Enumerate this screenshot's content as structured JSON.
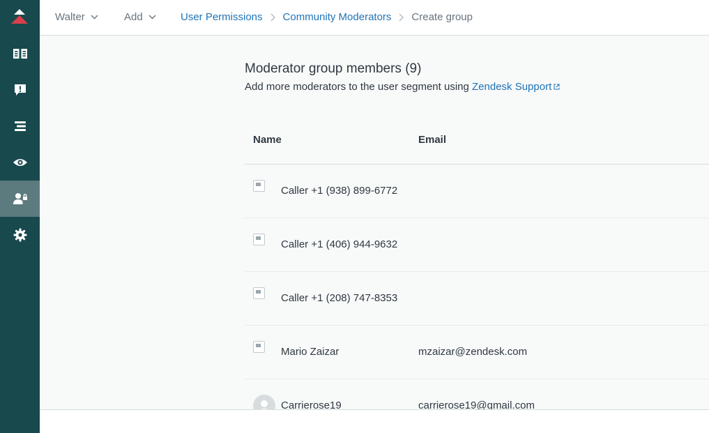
{
  "sidebar": {
    "logo_icon": "zendesk-guide-logo",
    "items": [
      {
        "icon": "open-book-icon",
        "active": false
      },
      {
        "icon": "alert-message-icon",
        "active": false
      },
      {
        "icon": "bars-list-icon",
        "active": false
      },
      {
        "icon": "eye-icon",
        "active": false
      },
      {
        "icon": "user-lock-icon",
        "active": true
      },
      {
        "icon": "gear-icon",
        "active": false
      }
    ],
    "colors": {
      "background": "#17494d",
      "active": "#5c7b7e",
      "logo_accent": "#d93f4c"
    }
  },
  "topbar": {
    "user_menu": "Walter",
    "add_menu": "Add",
    "breadcrumb": {
      "level1": "User Permissions",
      "level2": "Community Moderators",
      "current": "Create group"
    }
  },
  "section": {
    "title": "Moderator group members (9)",
    "description": "Add more moderators to the user segment using",
    "link": "Zendesk Support"
  },
  "table": {
    "columns": {
      "name": "Name",
      "email": "Email"
    },
    "rows": [
      {
        "name": "Caller +1 (938) 899-6772",
        "email": "",
        "avatar": "broken-image-icon"
      },
      {
        "name": "Caller +1 (406) 944-9632",
        "email": "",
        "avatar": "broken-image-icon"
      },
      {
        "name": "Caller +1 (208) 747-8353",
        "email": "",
        "avatar": "broken-image-icon"
      },
      {
        "name": "Mario Zaizar",
        "email": "mzaizar@zendesk.com",
        "avatar": "broken-image-icon"
      },
      {
        "name": "Carrierose19",
        "email": "carrierose19@gmail.com",
        "avatar": "default-avatar-icon"
      }
    ]
  },
  "colors": {
    "link": "#1f73b7",
    "text": "#2f3941",
    "muted": "#68737d"
  }
}
